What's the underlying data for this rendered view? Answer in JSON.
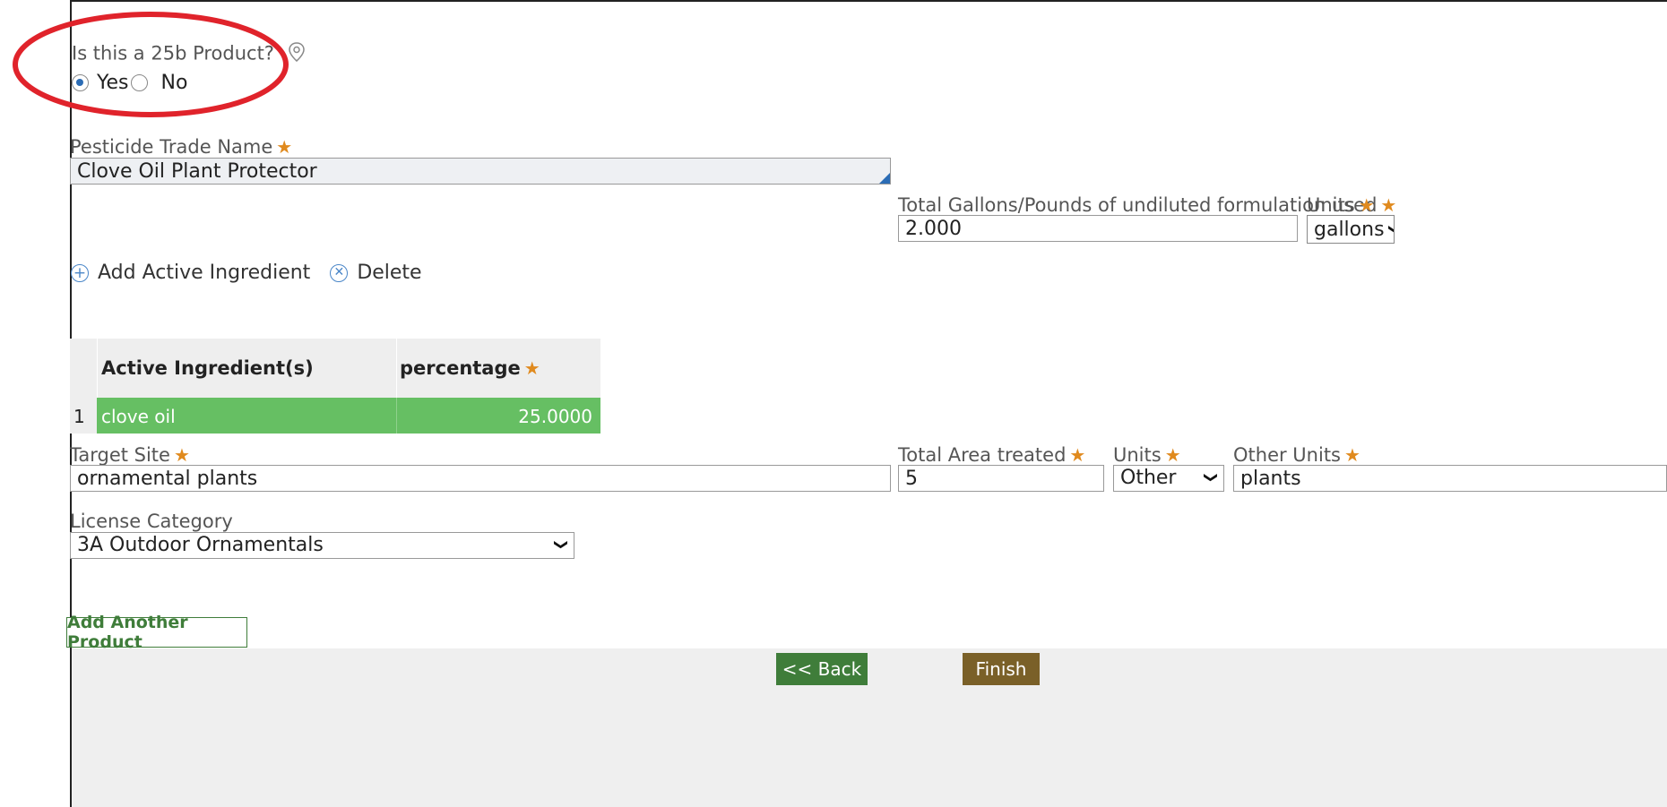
{
  "product_25b": {
    "question": "Is this a 25b Product?",
    "options": [
      {
        "label": "Yes",
        "selected": true
      },
      {
        "label": "No",
        "selected": false
      }
    ]
  },
  "trade_name": {
    "label": "Pesticide Trade Name",
    "value": "Clove Oil Plant Protector"
  },
  "total_formulation": {
    "label": "Total Gallons/Pounds of undiluted formulation used",
    "value": "2.000",
    "units_label": "Units",
    "units_value": "gallons"
  },
  "ingredient_actions": {
    "add_label": "Add Active Ingredient",
    "delete_label": "Delete"
  },
  "ingredients_table": {
    "columns": [
      "Active Ingredient(s)",
      "percentage"
    ],
    "rows": [
      {
        "index": "1",
        "ingredient": "clove oil",
        "percentage": "25.0000"
      }
    ]
  },
  "target_site": {
    "label": "Target Site",
    "value": "ornamental plants"
  },
  "area": {
    "label": "Total Area treated",
    "value": "5",
    "units_label": "Units",
    "units_value": "Other",
    "other_units_label": "Other Units",
    "other_units_value": "plants"
  },
  "license_category": {
    "label": "License Category",
    "value": "3A Outdoor Ornamentals"
  },
  "buttons": {
    "add_product": "Add Another Product",
    "back": "<< Back",
    "finish": "Finish"
  },
  "colors": {
    "annotation_circle": "#e0232b",
    "selected_row": "#66bf63",
    "required_star": "#e08a1e",
    "back_button": "#3f7d3a",
    "finish_button": "#7a6028",
    "icon_blue": "#4a86c8"
  },
  "icons": {
    "info": "location-pin-icon",
    "add": "plus-circle-icon",
    "delete": "x-circle-icon",
    "dropdown": "chevron-down-icon"
  }
}
